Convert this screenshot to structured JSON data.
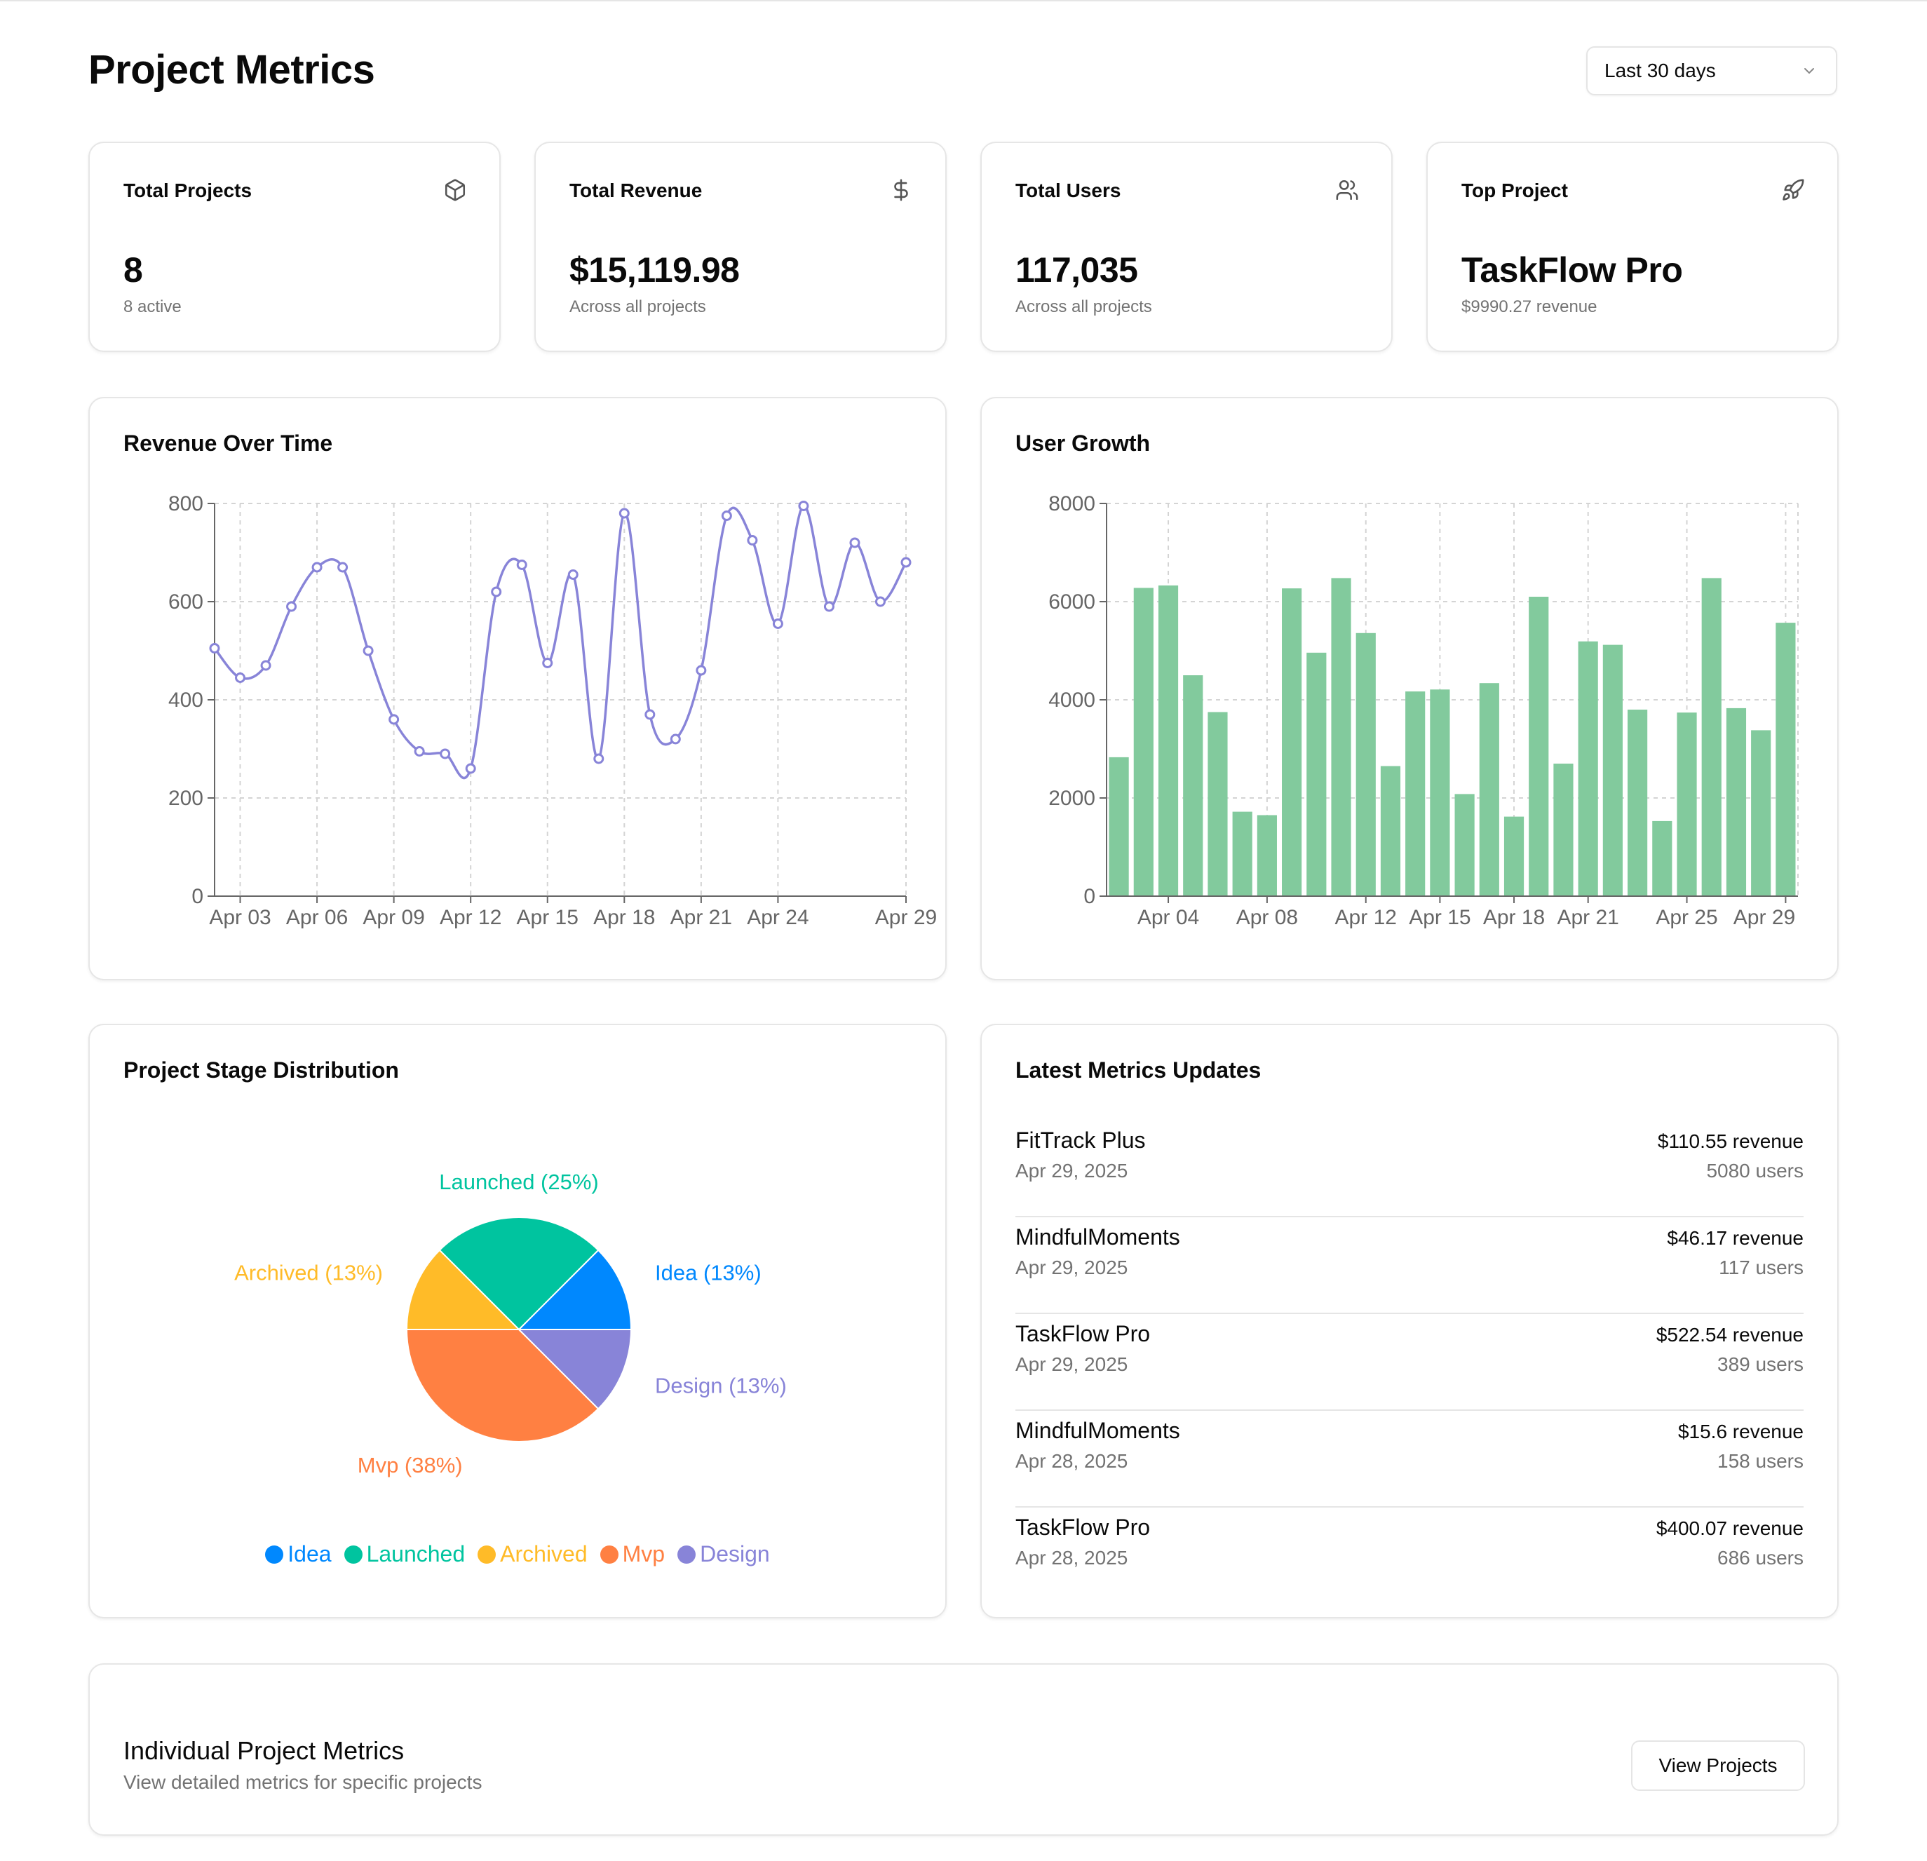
{
  "header": {
    "title": "Project Metrics",
    "range": "Last 30 days"
  },
  "stats": [
    {
      "title": "Total Projects",
      "value": "8",
      "sub": "8 active",
      "icon": "box-icon"
    },
    {
      "title": "Total Revenue",
      "value": "$15,119.98",
      "sub": "Across all projects",
      "icon": "dollar-icon"
    },
    {
      "title": "Total Users",
      "value": "117,035",
      "sub": "Across all projects",
      "icon": "users-icon"
    },
    {
      "title": "Top Project",
      "value": "TaskFlow Pro",
      "sub": "$9990.27 revenue",
      "icon": "rocket-icon"
    }
  ],
  "revenue_chart": {
    "title": "Revenue Over Time"
  },
  "users_chart": {
    "title": "User Growth"
  },
  "stage_chart": {
    "title": "Project Stage Distribution"
  },
  "chart_data": [
    {
      "type": "line",
      "title": "Revenue Over Time",
      "x": [
        "Apr 02",
        "Apr 03",
        "Apr 04",
        "Apr 05",
        "Apr 06",
        "Apr 07",
        "Apr 08",
        "Apr 09",
        "Apr 10",
        "Apr 11",
        "Apr 12",
        "Apr 13",
        "Apr 14",
        "Apr 15",
        "Apr 16",
        "Apr 17",
        "Apr 18",
        "Apr 19",
        "Apr 20",
        "Apr 21",
        "Apr 22",
        "Apr 23",
        "Apr 24",
        "Apr 25",
        "Apr 26",
        "Apr 27",
        "Apr 28",
        "Apr 29"
      ],
      "xticks": [
        "Apr 03",
        "Apr 06",
        "Apr 09",
        "Apr 12",
        "Apr 15",
        "Apr 18",
        "Apr 21",
        "Apr 24",
        "Apr 29"
      ],
      "series": [
        {
          "values": [
            505,
            445,
            470,
            590,
            670,
            670,
            500,
            360,
            295,
            290,
            260,
            620,
            675,
            475,
            655,
            280,
            780,
            370,
            320,
            460,
            775,
            725,
            555,
            795,
            590,
            720,
            600,
            680
          ]
        }
      ],
      "ylim": [
        0,
        800
      ],
      "yticks": [
        0,
        200,
        400,
        600,
        800
      ],
      "color": "#8884d8",
      "grid": true
    },
    {
      "type": "bar",
      "title": "User Growth",
      "x": [
        "Apr 01",
        "Apr 02",
        "Apr 03",
        "Apr 04",
        "Apr 05",
        "Apr 06",
        "Apr 07",
        "Apr 08",
        "Apr 09",
        "Apr 10",
        "Apr 11",
        "Apr 12",
        "Apr 13",
        "Apr 14",
        "Apr 15",
        "Apr 16",
        "Apr 17",
        "Apr 18",
        "Apr 19",
        "Apr 20",
        "Apr 21",
        "Apr 22",
        "Apr 23",
        "Apr 24",
        "Apr 25",
        "Apr 26",
        "Apr 27",
        "Apr 28"
      ],
      "xticks": [
        "Apr 04",
        "Apr 08",
        "Apr 12",
        "Apr 15",
        "Apr 18",
        "Apr 21",
        "Apr 25",
        "Apr 29"
      ],
      "series": [
        {
          "values": [
            2830,
            6280,
            6330,
            4500,
            3750,
            1720,
            1650,
            6270,
            4960,
            6480,
            5360,
            2650,
            4170,
            4210,
            2080,
            4340,
            1620,
            6100,
            2700,
            5190,
            5120,
            3800,
            1530,
            3740,
            6480,
            3830,
            3380,
            5570
          ]
        }
      ],
      "ylim": [
        0,
        8000
      ],
      "yticks": [
        0,
        2000,
        4000,
        6000,
        8000
      ],
      "color": "#82ca9d",
      "grid": true
    },
    {
      "type": "pie",
      "title": "Project Stage Distribution",
      "slices": [
        {
          "name": "Idea",
          "label": "Idea (13%)",
          "value": 12.5,
          "color": "#0088fe"
        },
        {
          "name": "Launched",
          "label": "Launched (25%)",
          "value": 25,
          "color": "#00c49f"
        },
        {
          "name": "Archived",
          "label": "Archived (13%)",
          "value": 12.5,
          "color": "#ffbb28"
        },
        {
          "name": "Mvp",
          "label": "Mvp (38%)",
          "value": 37.5,
          "color": "#ff8042"
        },
        {
          "name": "Design",
          "label": "Design (13%)",
          "value": 12.5,
          "color": "#8884d8"
        }
      ],
      "legend": "bottom"
    }
  ],
  "updates": {
    "title": "Latest Metrics Updates",
    "items": [
      {
        "name": "FitTrack Plus",
        "date": "Apr 29, 2025",
        "revenue": "$110.55 revenue",
        "users": "5080 users"
      },
      {
        "name": "MindfulMoments",
        "date": "Apr 29, 2025",
        "revenue": "$46.17 revenue",
        "users": "117 users"
      },
      {
        "name": "TaskFlow Pro",
        "date": "Apr 29, 2025",
        "revenue": "$522.54 revenue",
        "users": "389 users"
      },
      {
        "name": "MindfulMoments",
        "date": "Apr 28, 2025",
        "revenue": "$15.6 revenue",
        "users": "158 users"
      },
      {
        "name": "TaskFlow Pro",
        "date": "Apr 28, 2025",
        "revenue": "$400.07 revenue",
        "users": "686 users"
      }
    ]
  },
  "individual": {
    "title": "Individual Project Metrics",
    "subtitle": "View detailed metrics for specific projects",
    "button": "View Projects"
  }
}
